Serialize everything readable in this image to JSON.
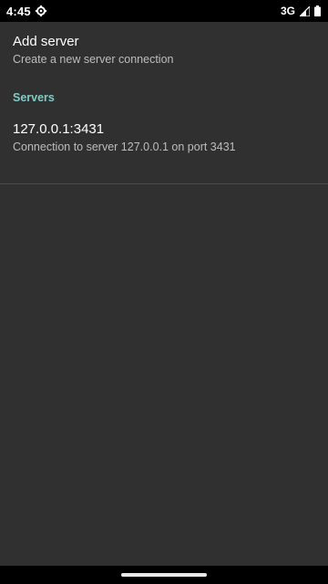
{
  "status_bar": {
    "time": "4:45",
    "network": "3G",
    "icons": [
      "settings-gear-icon",
      "signal-icon",
      "battery-icon"
    ]
  },
  "add_server": {
    "title": "Add server",
    "summary": "Create a new server connection"
  },
  "servers_category": {
    "label": "Servers"
  },
  "servers": [
    {
      "title": "127.0.0.1:3431",
      "summary": "Connection to server 127.0.0.1 on port 3431"
    }
  ],
  "colors": {
    "background": "#303030",
    "accent": "#80cbc4",
    "status_bar": "#000000"
  }
}
